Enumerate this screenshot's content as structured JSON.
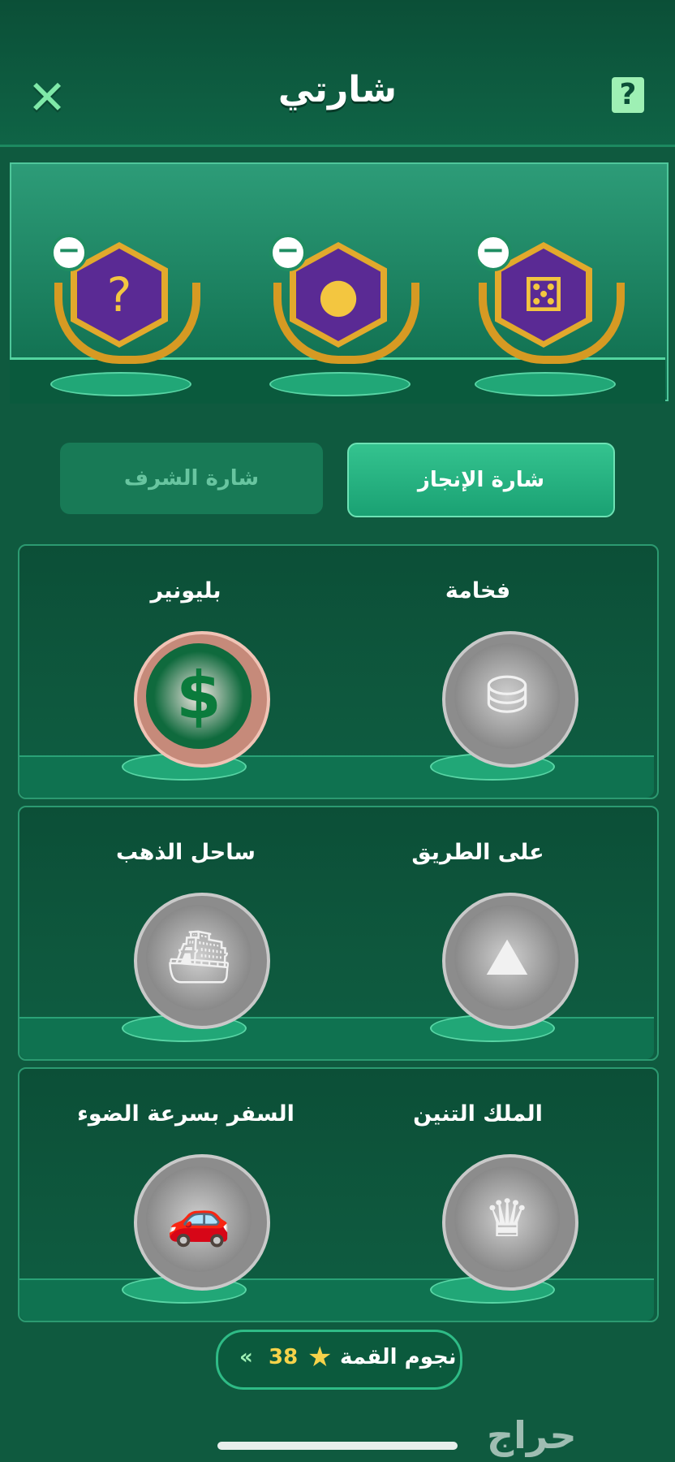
{
  "header": {
    "title": "شارتي",
    "close_symbol": "✕",
    "help_symbol": "?"
  },
  "showcase": {
    "badges": [
      {
        "name": "dice-badge",
        "icon": "⚄"
      },
      {
        "name": "coins-badge",
        "icon": "●"
      },
      {
        "name": "mystery-chest-badge",
        "icon": "?"
      }
    ],
    "remove_symbol": "−"
  },
  "tabs": [
    {
      "label": "شارة الإنجاز",
      "active": true
    },
    {
      "label": "شارة الشرف",
      "active": false
    }
  ],
  "achievements": [
    {
      "label": "فخامة",
      "icon": "treasure-icon",
      "glyph": "⛁",
      "locked": true
    },
    {
      "label": "بليونير",
      "icon": "dollar-icon",
      "glyph": "$",
      "locked": false
    },
    {
      "label": "على الطريق",
      "icon": "road-icon",
      "glyph": "⛰",
      "locked": true
    },
    {
      "label": "ساحل الذهب",
      "icon": "yacht-icon",
      "glyph": "⛴",
      "locked": true
    },
    {
      "label": "الملك التنين",
      "icon": "dragon-icon",
      "glyph": "♛",
      "locked": true
    },
    {
      "label": "السفر بسرعة الضوء",
      "icon": "car-icon",
      "glyph": "🚗",
      "locked": true
    }
  ],
  "footer": {
    "label": "نجوم القمة",
    "star": "★",
    "count": "38",
    "arrow": "«"
  },
  "watermark": "حراج"
}
